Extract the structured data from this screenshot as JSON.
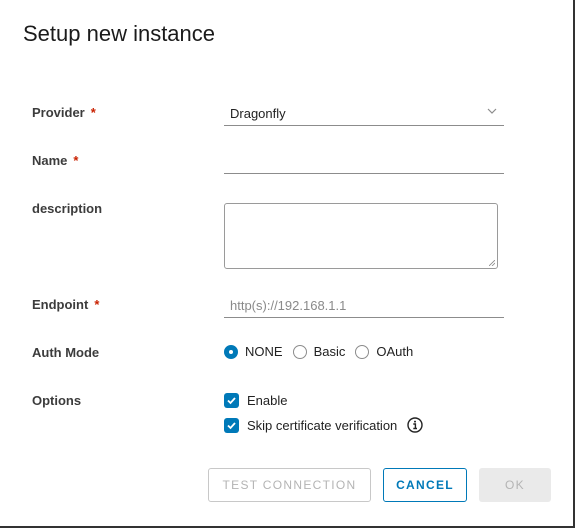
{
  "dialog": {
    "title": "Setup new instance"
  },
  "form": {
    "provider": {
      "label": "Provider",
      "required_mark": "*",
      "value": "Dragonfly"
    },
    "name": {
      "label": "Name",
      "required_mark": "*",
      "value": ""
    },
    "description": {
      "label": "description",
      "value": ""
    },
    "endpoint": {
      "label": "Endpoint",
      "required_mark": "*",
      "value": "",
      "placeholder": "http(s)://192.168.1.1"
    },
    "auth_mode": {
      "label": "Auth Mode",
      "selected": "NONE",
      "options": [
        "NONE",
        "Basic",
        "OAuth"
      ]
    },
    "options": {
      "label": "Options",
      "items": [
        {
          "label": "Enable",
          "checked": true
        },
        {
          "label": "Skip certificate verification",
          "checked": true,
          "info_icon": "info-circle-icon"
        }
      ]
    }
  },
  "footer": {
    "test_connection_label": "TEST CONNECTION",
    "cancel_label": "CANCEL",
    "ok_label": "OK"
  },
  "colors": {
    "primary": "#0079b8",
    "required": "#c92100",
    "disabled_text": "#b4b4b4"
  }
}
